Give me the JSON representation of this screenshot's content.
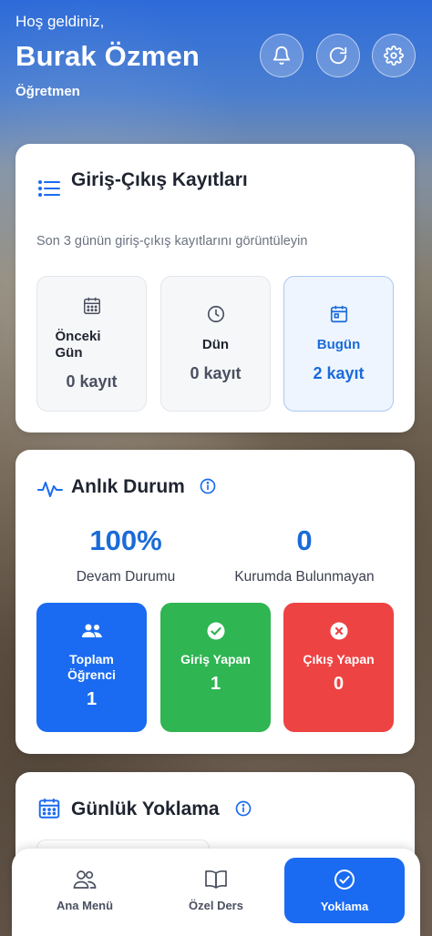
{
  "header": {
    "greeting": "Hoş geldiniz,",
    "user_name": "Burak Özmen",
    "role": "Öğretmen",
    "buttons": [
      {
        "icon": "bell-icon"
      },
      {
        "icon": "refresh-icon"
      },
      {
        "icon": "gear-icon"
      }
    ]
  },
  "entry_logs": {
    "title": "Giriş-Çıkış Kayıtları",
    "icon": "list-icon",
    "description": "Son 3 günün giriş-çıkış kayıtlarını görüntüleyin",
    "tiles": [
      {
        "label": "Önceki Gün",
        "count": "0 kayıt",
        "icon": "calendar-grid-icon",
        "active": false
      },
      {
        "label": "Dün",
        "count": "0 kayıt",
        "icon": "clock-icon",
        "active": false
      },
      {
        "label": "Bugün",
        "count": "2 kayıt",
        "icon": "calendar-today-icon",
        "active": true
      }
    ]
  },
  "live_status": {
    "title": "Anlık Durum",
    "icon": "pulse-icon",
    "info_icon": "info-icon",
    "attendance_value": "100%",
    "attendance_label": "Devam Durumu",
    "absent_value": "0",
    "absent_label": "Kurumda Bulunmayan",
    "cards": [
      {
        "label": "Toplam Öğrenci",
        "value": "1",
        "icon": "users-icon",
        "color": "#1a6bf2"
      },
      {
        "label": "Giriş Yapan",
        "value": "1",
        "icon": "check-circle-icon",
        "color": "#2fb552"
      },
      {
        "label": "Çıkış Yapan",
        "value": "0",
        "icon": "x-circle-icon",
        "color": "#ee4343"
      }
    ]
  },
  "daily_attendance": {
    "title": "Günlük Yoklama",
    "icon": "calendar-icon",
    "info_icon": "info-icon"
  },
  "bottom_nav": [
    {
      "label": "Ana Menü",
      "icon": "people-icon",
      "active": false
    },
    {
      "label": "Özel Ders",
      "icon": "book-icon",
      "active": false
    },
    {
      "label": "Yoklama",
      "icon": "check-circle-icon",
      "active": true
    }
  ],
  "colors": {
    "accent": "#1a6bf2",
    "success": "#2fb552",
    "danger": "#ee4343",
    "active_tile_text": "#1a6bd8"
  }
}
